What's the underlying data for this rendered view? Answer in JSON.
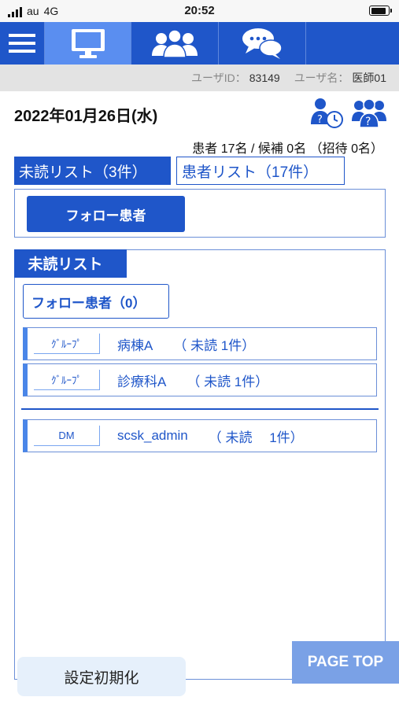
{
  "status_bar": {
    "carrier": "au",
    "network": "4G",
    "time": "20:52"
  },
  "nav": {
    "items": [
      {
        "icon": "menu-icon"
      },
      {
        "icon": "monitor-icon",
        "active": true
      },
      {
        "icon": "patients-group-icon"
      },
      {
        "icon": "chat-bubbles-icon"
      },
      {
        "icon": "blank"
      }
    ]
  },
  "user": {
    "id_label": "ユーザID：",
    "id_value": "83149",
    "name_label": "ユーザ名：",
    "name_value": "医師01"
  },
  "header": {
    "date": "2022年01月26日(水)",
    "counts": "患者 17名 / 候補 0名 （招待 0名）"
  },
  "tabs": {
    "unread": "未読リスト（3件）",
    "patients": "患者リスト（17件）"
  },
  "follow_button": "フォロー患者",
  "unread_panel": {
    "title": "未読リスト",
    "follow_count": "フォロー患者（0）",
    "rows": [
      {
        "tag": "ｸﾞﾙｰﾌﾟ",
        "name": "病棟A",
        "unread": "（ 未読 1件）"
      },
      {
        "tag": "ｸﾞﾙｰﾌﾟ",
        "name": "診療科A",
        "unread": "（ 未読 1件）"
      },
      {
        "tag": "DM",
        "name": "scsk_admin",
        "unread": "（ 未読　 1件）"
      }
    ]
  },
  "footer": {
    "reset": "設定初期化",
    "page_top": "PAGE TOP"
  },
  "colors": {
    "primary": "#1f56c9",
    "nav_active": "#5a8ef0",
    "row_accent": "#4a86e8",
    "page_top": "#7aa1e6"
  }
}
